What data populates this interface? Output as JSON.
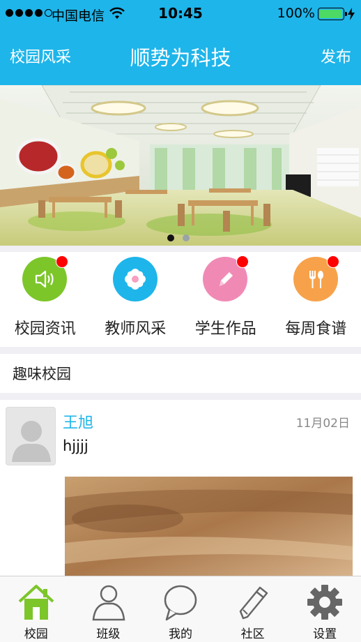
{
  "status_bar": {
    "carrier": "中国电信",
    "time": "10:45",
    "battery_percent": "100%",
    "signal_bars": 4,
    "battery_level": 1.0
  },
  "nav": {
    "left": "校园风采",
    "title": "顺势为科技",
    "right": "发布"
  },
  "banner": {
    "slide_count": 2,
    "active_index": 0
  },
  "menu": [
    {
      "label": "校园资讯",
      "icon": "speaker-icon",
      "color": "#7cc62a",
      "badge": true
    },
    {
      "label": "教师风采",
      "icon": "flower-icon",
      "color": "#1eb5ea",
      "badge": false
    },
    {
      "label": "学生作品",
      "icon": "pencil-icon",
      "color": "#f08ab5",
      "badge": true
    },
    {
      "label": "每周食谱",
      "icon": "fork-spoon-icon",
      "color": "#f7a24a",
      "badge": true
    }
  ],
  "section": {
    "title": "趣味校园"
  },
  "post": {
    "author": "王旭",
    "date": "11月02日",
    "content": "hjjjj"
  },
  "tabs": [
    {
      "label": "校园",
      "icon": "home-icon",
      "active": true
    },
    {
      "label": "班级",
      "icon": "person-icon",
      "active": false
    },
    {
      "label": "我的",
      "icon": "chat-bubble-icon",
      "active": false
    },
    {
      "label": "社区",
      "icon": "pencil-icon",
      "active": false
    },
    {
      "label": "设置",
      "icon": "gear-icon",
      "active": false
    }
  ],
  "colors": {
    "accent": "#1eb5ea",
    "active_tab": "#7cc62a",
    "badge": "#ff0000"
  }
}
